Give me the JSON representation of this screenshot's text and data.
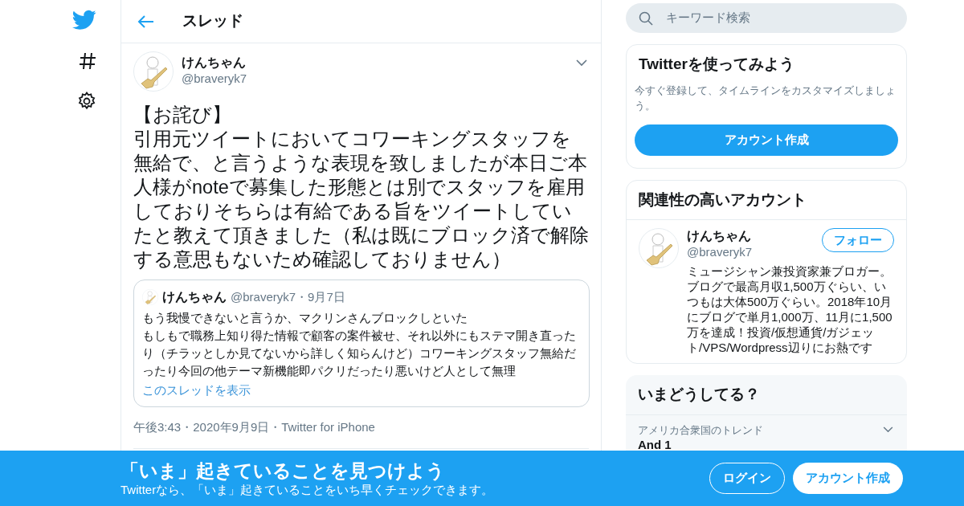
{
  "header": {
    "title": "スレッド"
  },
  "tweet": {
    "author_name": "けんちゃん",
    "handle": "@braveryk7",
    "paragraphs": [
      "【お詫び】",
      "引用元ツイートにおいてコワーキングスタッフを無給で、と言うような表現を致しましたが本日ご本人様がnoteで募集した形態とは別でスタッフを雇用しておりそちらは有給である旨をツイートしていたと教えて頂きました（私は既にブロック済で解除する意思もないため確認しておりません）"
    ],
    "quote": {
      "author_name": "けんちゃん",
      "handle": "@braveryk7",
      "date": "・9月7日",
      "paragraphs": [
        "もう我慢できないと言うか、マクリンさんブロックしといた",
        "もしもで職務上知り得た情報で顧客の案件被せ、それ以外にもステマ開き直ったり（チラッとしか見てないから詳しく知らんけど）コワーキングスタッフ無給だったり今回の他テーマ新機能即パクリだったり悪いけど人として無理"
      ],
      "link": "このスレッドを表示"
    },
    "meta": "午後3:43・2020年9月9日・Twitter for iPhone"
  },
  "search": {
    "placeholder": "キーワード検索"
  },
  "signup_card": {
    "title": "Twitterを使ってみよう",
    "description": "今すぐ登録して、タイムラインをカスタマイズしましょう。",
    "button": "アカウント作成"
  },
  "related": {
    "title": "関連性の高いアカウント",
    "accounts": [
      {
        "name": "けんちゃん",
        "handle": "@braveryk7",
        "bio": "ミュージシャン兼投資家兼ブロガー。ブログで最高月収1,500万ぐらい、いつもは大体500万ぐらい。2018年10月にブログで単月1,000万、11月に1,500万を達成！投資/仮想通貨/ガジェット/VPS/Wordpress辺りにお熱です",
        "button": "フォロー"
      }
    ]
  },
  "trends": {
    "title": "いまどうしてる？",
    "items": [
      {
        "context": "アメリカ合衆国のトレンド",
        "name": "And 1"
      }
    ]
  },
  "bottom_banner": {
    "title": "「いま」起きていることを見つけよう",
    "subtitle": "Twitterなら、「いま」起きていることをいち早くチェックできます。",
    "buttons": [
      {
        "label": "ログイン",
        "kind": "outline"
      },
      {
        "label": "アカウント作成",
        "kind": "filled"
      }
    ]
  }
}
